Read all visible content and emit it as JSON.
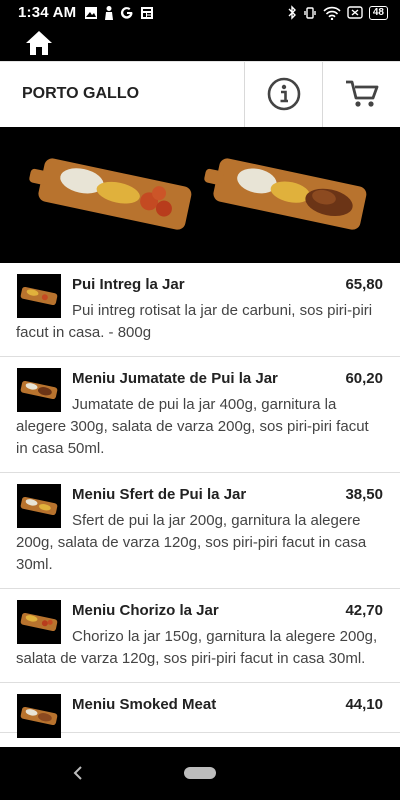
{
  "status_bar": {
    "time": "1:34 AM",
    "battery": "48"
  },
  "header": {
    "restaurant_name": "PORTO GALLO"
  },
  "menu_items": [
    {
      "name": "Pui Intreg la Jar",
      "price": "65,80",
      "description": "Pui intreg rotisat la jar de carbuni, sos piri-piri facut in casa. - 800g"
    },
    {
      "name": "Meniu Jumatate de Pui la Jar",
      "price": "60,20",
      "description": "Jumatate de pui la jar 400g, garnitura la alegere 300g, salata de varza 200g, sos piri-piri facut in casa 50ml."
    },
    {
      "name": "Meniu Sfert de Pui la Jar",
      "price": "38,50",
      "description": "Sfert de pui la jar 200g, garnitura la alegere 200g, salata de varza 120g, sos piri-piri facut in casa 30ml."
    },
    {
      "name": "Meniu Chorizo la Jar",
      "price": "42,70",
      "description": "Chorizo la jar 150g, garnitura la alegere 200g, salata de varza 120g, sos piri-piri facut in casa 30ml."
    },
    {
      "name": "Meniu Smoked Meat",
      "price": "44,10",
      "description": ""
    }
  ],
  "icons": {
    "home": "home-icon",
    "info": "info-icon",
    "cart": "cart-icon",
    "back": "back-icon",
    "gallery": "gallery-icon",
    "bluetooth": "bluetooth-icon",
    "wifi": "wifi-icon"
  },
  "colors": {
    "bars": "#000000",
    "text": "#222222",
    "desc": "#444444"
  }
}
